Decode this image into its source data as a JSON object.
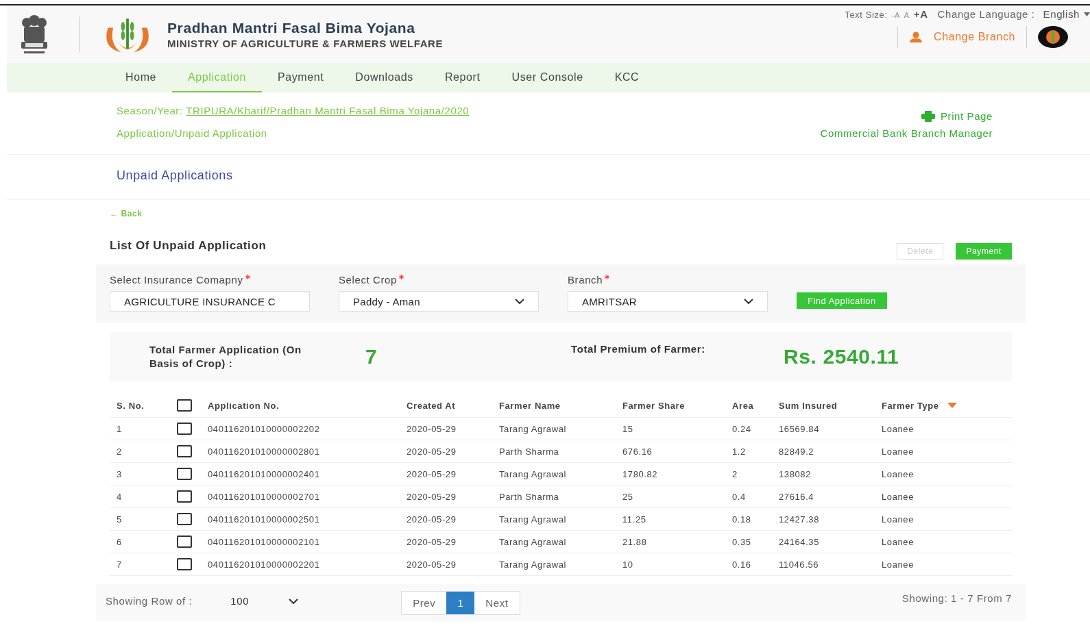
{
  "header": {
    "title": "Pradhan Mantri Fasal Bima Yojana",
    "subtitle": "MINISTRY OF AGRICULTURE & FARMERS WELFARE",
    "text_size_label": "Text Size:",
    "text_size_options": [
      "-A",
      "A",
      "+A"
    ],
    "language_label": "Change Language :",
    "language": "English",
    "change_branch": "Change Branch"
  },
  "nav": [
    {
      "label": "Home",
      "selected": false
    },
    {
      "label": "Application",
      "selected": true
    },
    {
      "label": "Payment",
      "selected": false
    },
    {
      "label": "Downloads",
      "selected": false
    },
    {
      "label": "Report",
      "selected": false
    },
    {
      "label": "User Console",
      "selected": false
    },
    {
      "label": "KCC",
      "selected": false
    }
  ],
  "breadcrumb": {
    "season_label": "Season/Year:",
    "season_link": "TRIPURA/Kharif/Pradhan Mantri Fasal Bima Yojana/2020",
    "path": "Application/Unpaid Application",
    "print": "Print Page",
    "role": "Commercial Bank Branch Manager"
  },
  "page_title": "Unpaid Applications",
  "back": "← Back",
  "list_title": "List Of Unpaid Application",
  "actions": [
    {
      "label": "Delete",
      "disabled": true
    },
    {
      "label": "Payment",
      "disabled": false
    }
  ],
  "filters": [
    {
      "label": "Select Insurance Comapny",
      "value": "AGRICULTURE INSURANCE C",
      "kind": "text",
      "required": true
    },
    {
      "label": "Select Crop",
      "value": "Paddy - Aman",
      "kind": "select",
      "required": true
    },
    {
      "label": "Branch",
      "value": "AMRITSAR",
      "kind": "select",
      "required": true
    }
  ],
  "find_button": "Find Application",
  "summary": {
    "applications_label": "Total Farmer Application (On Basis of Crop) :",
    "applications": "7",
    "premium_label": "Total Premium of Farmer:",
    "premium": "Rs. 2540.11"
  },
  "table": {
    "columns": [
      "S. No.",
      "Application No.",
      "Created At",
      "Farmer Name",
      "Farmer Share",
      "Area",
      "Sum Insured",
      "Farmer Type"
    ],
    "all_checked": false,
    "rows": [
      {
        "sno": "1",
        "checked": false,
        "app": "040116201010000002202",
        "created": "2020-05-29",
        "name": "Tarang Agrawal",
        "share": "15",
        "area": "0.24",
        "sum": "16569.84",
        "type": "Loanee"
      },
      {
        "sno": "2",
        "checked": false,
        "app": "040116201010000002801",
        "created": "2020-05-29",
        "name": "Parth Sharma",
        "share": "676.16",
        "area": "1.2",
        "sum": "82849.2",
        "type": "Loanee"
      },
      {
        "sno": "3",
        "checked": false,
        "app": "040116201010000002401",
        "created": "2020-05-29",
        "name": "Tarang Agrawal",
        "share": "1780.82",
        "area": "2",
        "sum": "138082",
        "type": "Loanee"
      },
      {
        "sno": "4",
        "checked": false,
        "app": "040116201010000002701",
        "created": "2020-05-29",
        "name": "Parth Sharma",
        "share": "25",
        "area": "0.4",
        "sum": "27616.4",
        "type": "Loanee"
      },
      {
        "sno": "5",
        "checked": false,
        "app": "040116201010000002501",
        "created": "2020-05-29",
        "name": "Tarang Agrawal",
        "share": "11.25",
        "area": "0.18",
        "sum": "12427.38",
        "type": "Loanee"
      },
      {
        "sno": "6",
        "checked": false,
        "app": "040116201010000002101",
        "created": "2020-05-29",
        "name": "Tarang Agrawal",
        "share": "21.88",
        "area": "0.35",
        "sum": "24164.35",
        "type": "Loanee"
      },
      {
        "sno": "7",
        "checked": false,
        "app": "040116201010000002201",
        "created": "2020-05-29",
        "name": "Tarang Agrawal",
        "share": "10",
        "area": "0.16",
        "sum": "11046.56",
        "type": "Loanee"
      }
    ]
  },
  "footer": {
    "rows_label": "Showing Row of :",
    "rows_value": "100",
    "pages": [
      {
        "label": "Prev",
        "selected": false
      },
      {
        "label": "1",
        "selected": true
      },
      {
        "label": "Next",
        "selected": false
      }
    ],
    "showing": "Showing: 1 - 7 From 7"
  }
}
